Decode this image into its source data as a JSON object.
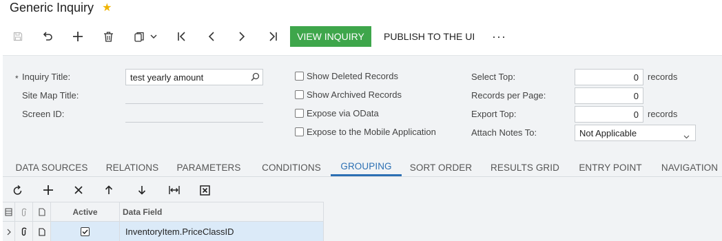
{
  "header": {
    "title": "Generic Inquiry"
  },
  "toolbar": {
    "view_inquiry": "VIEW INQUIRY",
    "publish": "PUBLISH TO THE UI",
    "more": "···"
  },
  "form": {
    "inquiry_title_label": "Inquiry Title:",
    "inquiry_title_value": "test yearly amount",
    "site_map_title_label": "Site Map Title:",
    "screen_id_label": "Screen ID:",
    "show_deleted": "Show Deleted Records",
    "show_archived": "Show Archived Records",
    "expose_odata": "Expose via OData",
    "expose_mobile": "Expose to the Mobile Application",
    "select_top_label": "Select Top:",
    "select_top_value": "0",
    "records_per_page_label": "Records per Page:",
    "records_per_page_value": "0",
    "export_top_label": "Export Top:",
    "export_top_value": "0",
    "records_suffix": "records",
    "attach_notes_label": "Attach Notes To:",
    "attach_notes_value": "Not Applicable"
  },
  "tabs": [
    "DATA SOURCES",
    "RELATIONS",
    "PARAMETERS",
    "CONDITIONS",
    "GROUPING",
    "SORT ORDER",
    "RESULTS GRID",
    "ENTRY POINT",
    "NAVIGATION"
  ],
  "active_tab": "GROUPING",
  "grid": {
    "columns": {
      "active": "Active",
      "data_field": "Data Field"
    },
    "rows": [
      {
        "active": true,
        "data_field": "InventoryItem.PriceClassID"
      }
    ]
  },
  "colors": {
    "accent": "#2b6fb3",
    "primary_button": "#3ea64b",
    "star": "#f0b400",
    "selected_row": "#dbeaf8"
  }
}
